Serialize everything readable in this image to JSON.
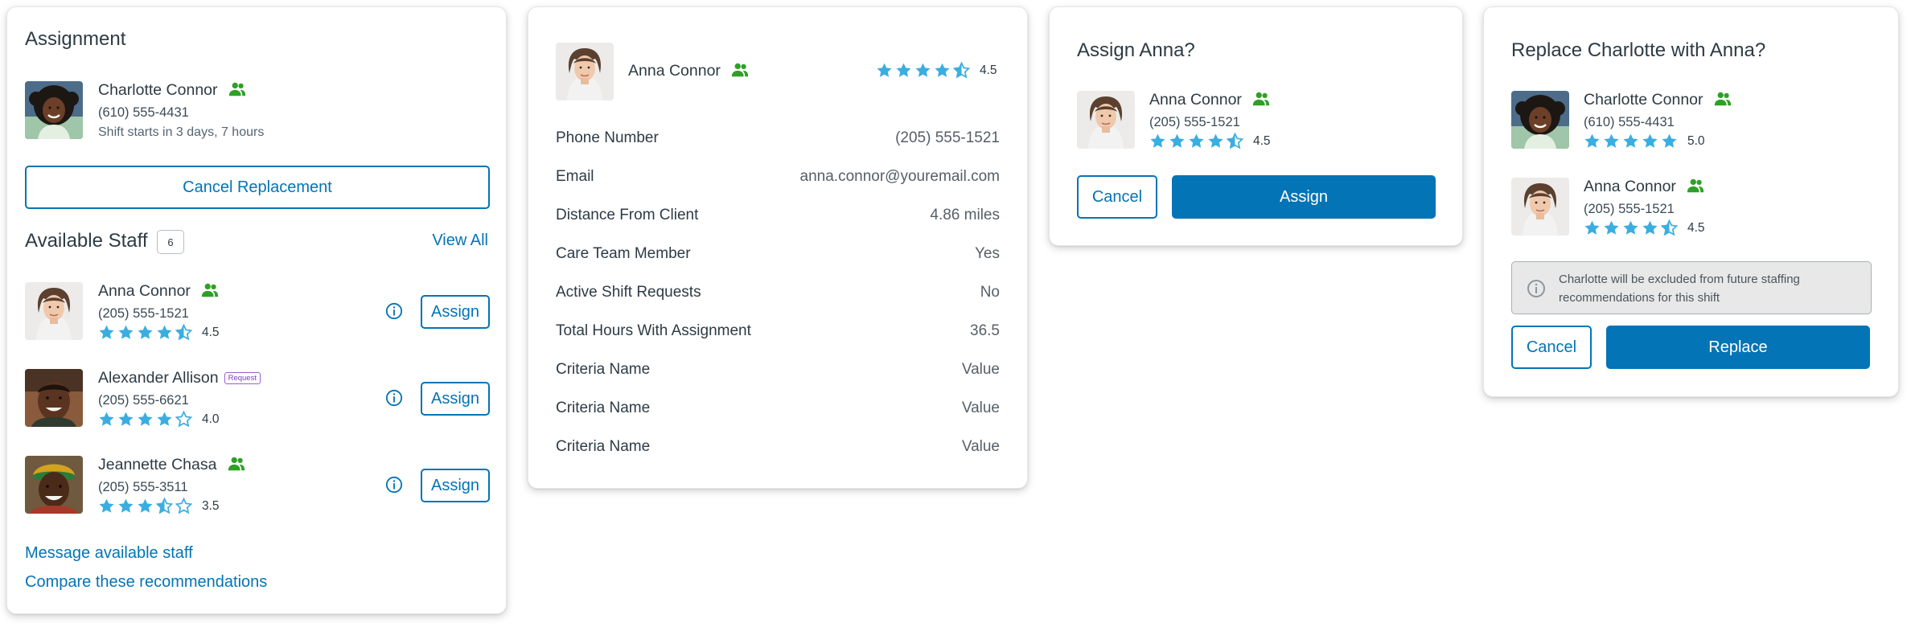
{
  "colors": {
    "accent": "#0374b5",
    "star": "#3aaee0",
    "group_icon": "#2ea026",
    "request": "#7b3fbf"
  },
  "assignment_card": {
    "title": "Assignment",
    "current": {
      "name": "Charlotte Connor",
      "phone": "(610) 555-4431",
      "shift": "Shift starts in 3 days, 7 hours",
      "icon": "group-icon"
    },
    "cancel_replacement_label": "Cancel Replacement",
    "available_staff_title": "Available Staff",
    "available_count": "6",
    "view_all_label": "View All",
    "staff": [
      {
        "name": "Anna Connor",
        "phone": "(205) 555-1521",
        "rating": "4.5",
        "rating_value": 4.5,
        "badge": "",
        "assign_label": "Assign"
      },
      {
        "name": "Alexander Allison",
        "phone": "(205) 555-6621",
        "rating": "4.0",
        "rating_value": 4.0,
        "badge": "Request",
        "assign_label": "Assign"
      },
      {
        "name": "Jeannette Chasa",
        "phone": "(205) 555-3511",
        "rating": "3.5",
        "rating_value": 3.5,
        "badge": "",
        "assign_label": "Assign"
      }
    ],
    "message_link": "Message available staff",
    "compare_link": "Compare these recommendations"
  },
  "profile_card": {
    "name": "Anna Connor",
    "rating": "4.5",
    "rating_value": 4.5,
    "rows": [
      {
        "label": "Phone Number",
        "value": "(205) 555-1521"
      },
      {
        "label": "Email",
        "value": "anna.connor@youremail.com"
      },
      {
        "label": "Distance From Client",
        "value": "4.86 miles"
      },
      {
        "label": "Care Team Member",
        "value": "Yes"
      },
      {
        "label": "Active Shift Requests",
        "value": "No"
      },
      {
        "label": "Total Hours With Assignment",
        "value": "36.5"
      },
      {
        "label": "Criteria Name",
        "value": "Value"
      },
      {
        "label": "Criteria Name",
        "value": "Value"
      },
      {
        "label": "Criteria Name",
        "value": "Value"
      }
    ]
  },
  "assign_dialog": {
    "title": "Assign Anna?",
    "person": {
      "name": "Anna Connor",
      "phone": "(205) 555-1521",
      "rating": "4.5",
      "rating_value": 4.5
    },
    "cancel_label": "Cancel",
    "assign_label": "Assign"
  },
  "replace_dialog": {
    "title": "Replace Charlotte with Anna?",
    "people": [
      {
        "name": "Charlotte Connor",
        "phone": "(610) 555-4431",
        "rating": "5.0",
        "rating_value": 5.0
      },
      {
        "name": "Anna Connor",
        "phone": "(205) 555-1521",
        "rating": "4.5",
        "rating_value": 4.5
      }
    ],
    "notice": "Charlotte will be excluded from future staffing recommendations for this shift",
    "cancel_label": "Cancel",
    "replace_label": "Replace"
  }
}
